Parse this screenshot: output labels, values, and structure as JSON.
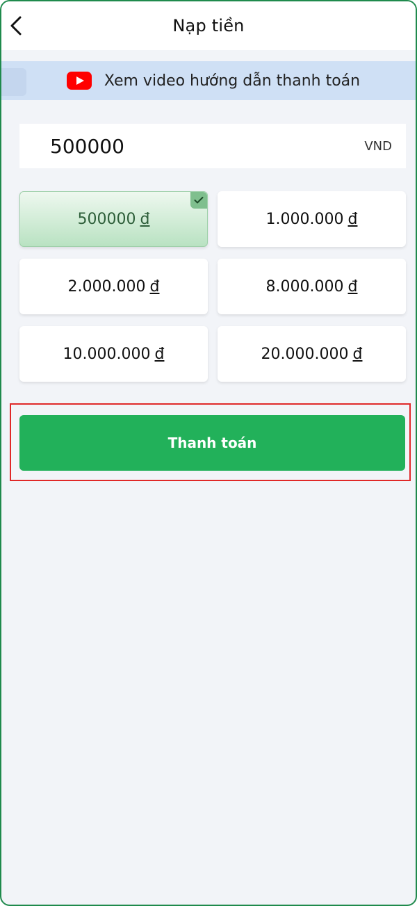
{
  "header": {
    "title": "Nạp tiền",
    "back_icon": "chevron-left-icon"
  },
  "banner": {
    "icon": "youtube-icon",
    "text": "Xem video hướng dẫn thanh toán",
    "icon_color": "#ff0000"
  },
  "amount": {
    "value": "500000",
    "unit": "VND"
  },
  "presets": [
    {
      "amount": "500000",
      "currency": "đ",
      "selected": true
    },
    {
      "amount": "1.000.000",
      "currency": "đ",
      "selected": false
    },
    {
      "amount": "2.000.000",
      "currency": "đ",
      "selected": false
    },
    {
      "amount": "8.000.000",
      "currency": "đ",
      "selected": false
    },
    {
      "amount": "10.000.000",
      "currency": "đ",
      "selected": false
    },
    {
      "amount": "20.000.000",
      "currency": "đ",
      "selected": false
    }
  ],
  "pay_button": {
    "label": "Thanh toán",
    "color": "#22b15a"
  },
  "colors": {
    "accent": "#22b15a",
    "highlight_outline": "#e02828",
    "banner_bg": "#cfe0f5"
  }
}
